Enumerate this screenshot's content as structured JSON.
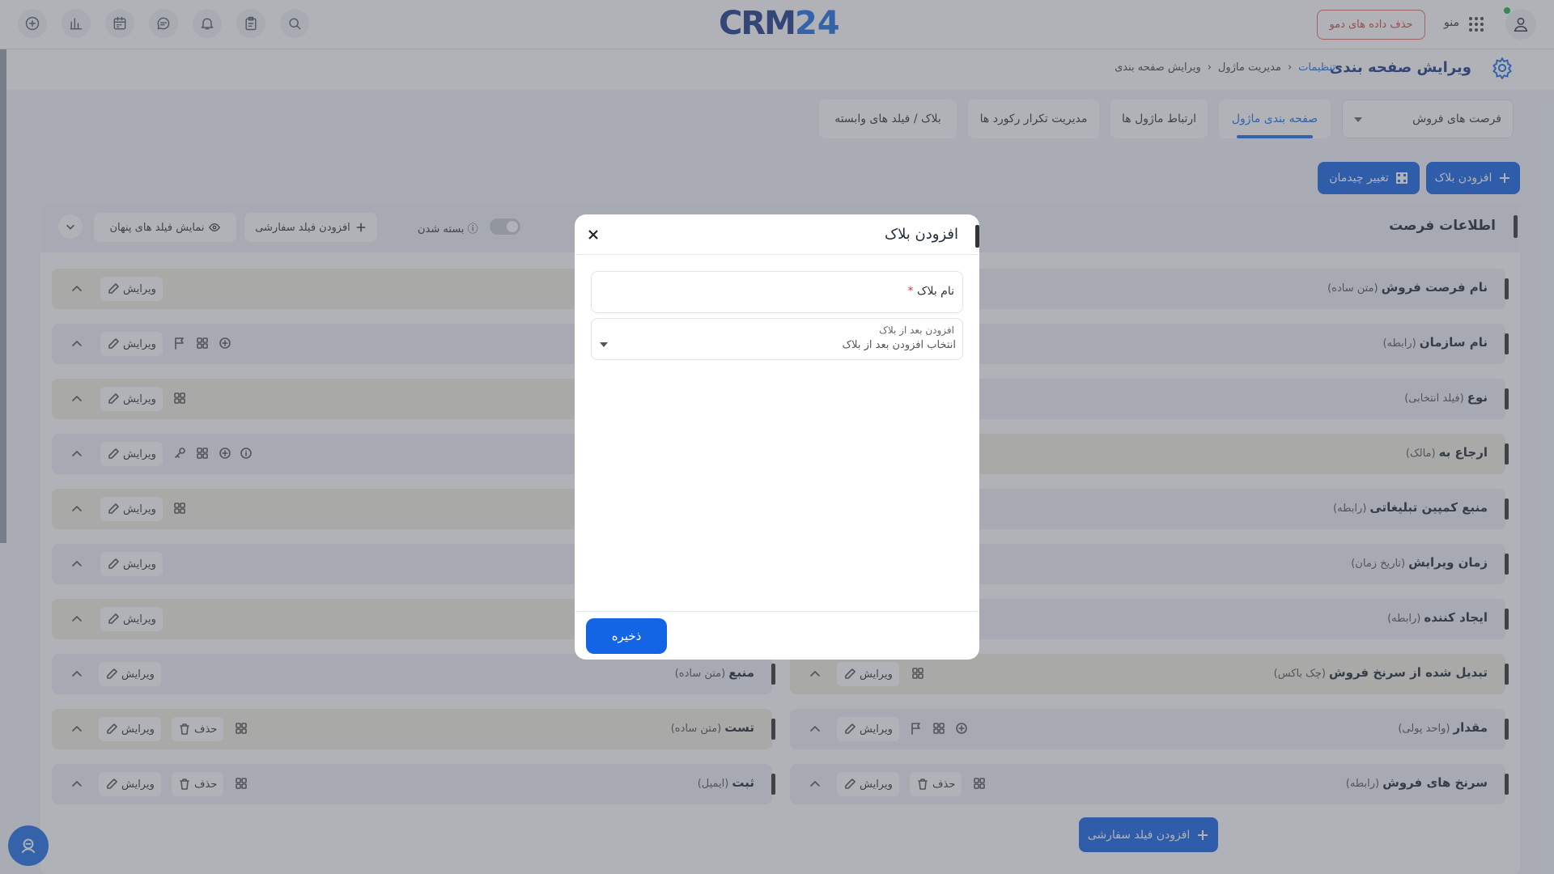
{
  "header": {
    "logo_prefix": "CRM",
    "logo_number": "24",
    "delete_demo_label": "حذف داده های دمو",
    "menu_label": "منو"
  },
  "subheader": {
    "title": "ویرایش صفحه بندی",
    "breadcrumb": [
      "تنظیمات",
      "مدیریت ماژول",
      "ویرایش صفحه بندی"
    ]
  },
  "module_select": {
    "value": "فرصت های فروش"
  },
  "tabs": [
    {
      "label": "صفحه بندی ماژول",
      "active": true
    },
    {
      "label": "ارتباط ماژول ها",
      "active": false
    },
    {
      "label": "مدیریت تکرار رکورد ها",
      "active": false
    },
    {
      "label": "بلاک / فیلد های وابسته",
      "active": false
    }
  ],
  "actions": {
    "add_block": "افزودن بلاک",
    "change_layout": "تغییر چیدمان"
  },
  "panel": {
    "title": "اطلاعات فرصت",
    "collapsed_label": "بسته شدن",
    "add_custom_field": "افزودن فیلد سفارشی",
    "show_hidden_fields": "نمایش فیلد های پنهان",
    "edit_label": "ویرایش",
    "delete_label": "حذف",
    "bottom_add_custom_field": "افزودن فیلد سفارشی"
  },
  "right_fields": [
    {
      "name": "نام فرصت فروش",
      "type": "(متن ساده)"
    },
    {
      "name": "نام سازمان",
      "type": "(رابطه)"
    },
    {
      "name": "نوع",
      "type": "(فیلد انتخابی)"
    },
    {
      "name": "ارجاع به",
      "type": "(مالک)"
    },
    {
      "name": "منبع کمپین تبلیغاتی",
      "type": "(رابطه)"
    },
    {
      "name": "زمان ویرایش",
      "type": "(تاریخ زمان)"
    },
    {
      "name": "ایجاد کننده",
      "type": "(رابطه)"
    },
    {
      "name": "تبدیل شده از سرنخ فروش",
      "type": "(چک باکس)"
    },
    {
      "name": "مقدار",
      "type": "(واحد پولی)"
    },
    {
      "name": "سرنخ های فروش",
      "type": "(رابطه)"
    }
  ],
  "left_fields": [
    {
      "name": "منبع",
      "type": "(متن ساده)"
    },
    {
      "name": "تست",
      "type": "(متن ساده)"
    },
    {
      "name": "ثبت",
      "type": "(ایمیل)"
    }
  ],
  "modal": {
    "title": "افزودن بلاک",
    "block_name_label": "نام بلاک",
    "required_mark": "*",
    "after_block_label": "افزودن بعد از بلاک",
    "after_block_placeholder": "انتخاب افزودن بعد از بلاک",
    "save_label": "ذخیره"
  },
  "colors": {
    "primary": "#1464e6",
    "brand_dark": "#1e3b8a",
    "row_blue": "#eef1f6",
    "row_tan": "#f3eee3",
    "demo_red": "#d64545"
  }
}
